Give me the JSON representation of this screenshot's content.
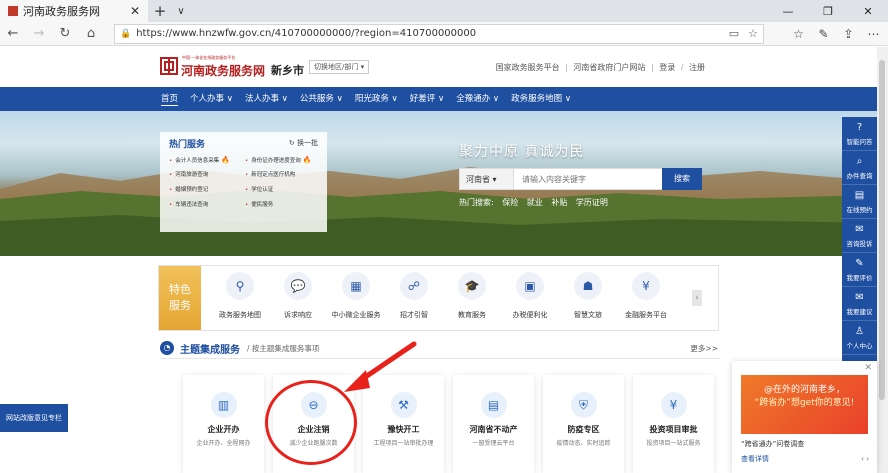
{
  "browser": {
    "tab_title": "河南政务服务网",
    "tab_close": "✕",
    "new_tab": "+",
    "tab_arrow": "∨",
    "url": "https://www.hnzwfw.gov.cn/410700000000/?region=410700000000",
    "win_min": "—",
    "win_max": "❐",
    "win_close": "✕"
  },
  "site": {
    "logo_small": "中国·一体化在线政务服务平台",
    "logo_text": "河南政务服务网",
    "city": "新乡市",
    "switch_region": "切换地区/部门 ▾",
    "top_links": [
      "国家政务服务平台",
      "河南省政府门户网站",
      "登录",
      "注册"
    ]
  },
  "nav": [
    {
      "label": "首页"
    },
    {
      "label": "个人办事 ∨"
    },
    {
      "label": "法人办事 ∨"
    },
    {
      "label": "公共服务 ∨"
    },
    {
      "label": "阳光政务 ∨"
    },
    {
      "label": "好差评 ∨"
    },
    {
      "label": "全豫通办 ∨"
    },
    {
      "label": "政务服务地图 ∨"
    }
  ],
  "banner": {
    "hot_title": "热门服务",
    "hot_refresh": "↻ 换一批",
    "hot_items": [
      {
        "label": "会计人员信息采集",
        "fire": true
      },
      {
        "label": "身份证办理进度查询",
        "fire": true
      },
      {
        "label": "河南旅游查询",
        "fire": false
      },
      {
        "label": "新冠定点医疗机构",
        "fire": false
      },
      {
        "label": "婚姻预约登记",
        "fire": false
      },
      {
        "label": "学位认证",
        "fire": false
      },
      {
        "label": "车辆违法查询",
        "fire": false
      },
      {
        "label": "便民服务",
        "fire": false
      }
    ],
    "slogan": "聚力中原  真诚为民",
    "search_select": "河南省  ▾",
    "search_placeholder": "请输入内容关键字",
    "search_button": "搜索",
    "hot_search_label": "热门搜索:",
    "hot_search_terms": [
      "保险",
      "就业",
      "补贴",
      "学历证明"
    ]
  },
  "right_bar": [
    {
      "icon": "?",
      "label": "智能问答"
    },
    {
      "icon": "⌕",
      "label": "办件查询"
    },
    {
      "icon": "▤",
      "label": "在线预约"
    },
    {
      "icon": "✉",
      "label": "咨询投诉"
    },
    {
      "icon": "✎",
      "label": "我要评价"
    },
    {
      "icon": "✉",
      "label": "我要建议"
    },
    {
      "icon": "♙",
      "label": "个人中心"
    }
  ],
  "featured": {
    "tag_line1": "特色",
    "tag_line2": "服务",
    "items": [
      {
        "icon": "⚲",
        "label": "政务服务地图"
      },
      {
        "icon": "💬",
        "label": "诉求响应"
      },
      {
        "icon": "▦",
        "label": "中小微企业服务"
      },
      {
        "icon": "☍",
        "label": "招才引智"
      },
      {
        "icon": "🎓",
        "label": "教育服务"
      },
      {
        "icon": "▣",
        "label": "办税便利化"
      },
      {
        "icon": "☗",
        "label": "智慧文旅"
      },
      {
        "icon": "¥",
        "label": "金融服务平台"
      }
    ],
    "next": "›"
  },
  "theme": {
    "title": "主题集成服务",
    "subtitle": "/ 按主题集成服务事项",
    "more": "更多>>",
    "cards": [
      {
        "icon": "▥",
        "title": "企业开办",
        "desc": "企业开办、全程网办"
      },
      {
        "icon": "⊖",
        "title": "企业注销",
        "desc": "减少企业跑腿次数"
      },
      {
        "icon": "⚒",
        "title": "豫快开工",
        "desc": "工程项目一站审批办理"
      },
      {
        "icon": "▤",
        "title": "河南省不动产",
        "desc": "一窗受理云平台"
      },
      {
        "icon": "⛨",
        "title": "防疫专区",
        "desc": "疫情动态、实时追踪"
      },
      {
        "icon": "¥",
        "title": "投资项目审批",
        "desc": "投资项目一站式服务"
      }
    ]
  },
  "feedback_tab": "网站改版意见专栏",
  "ad": {
    "close": "✕",
    "line1": "@在外的河南老乡，",
    "line2": "“跨省办”想get你的意见!",
    "caption": "“跨省通办”问卷调查",
    "link": "查看详情",
    "nav": "‹  ›"
  },
  "colors": {
    "brand_blue": "#1f4fa0",
    "logo_red": "#b72020",
    "annotation_red": "#e8211a"
  }
}
